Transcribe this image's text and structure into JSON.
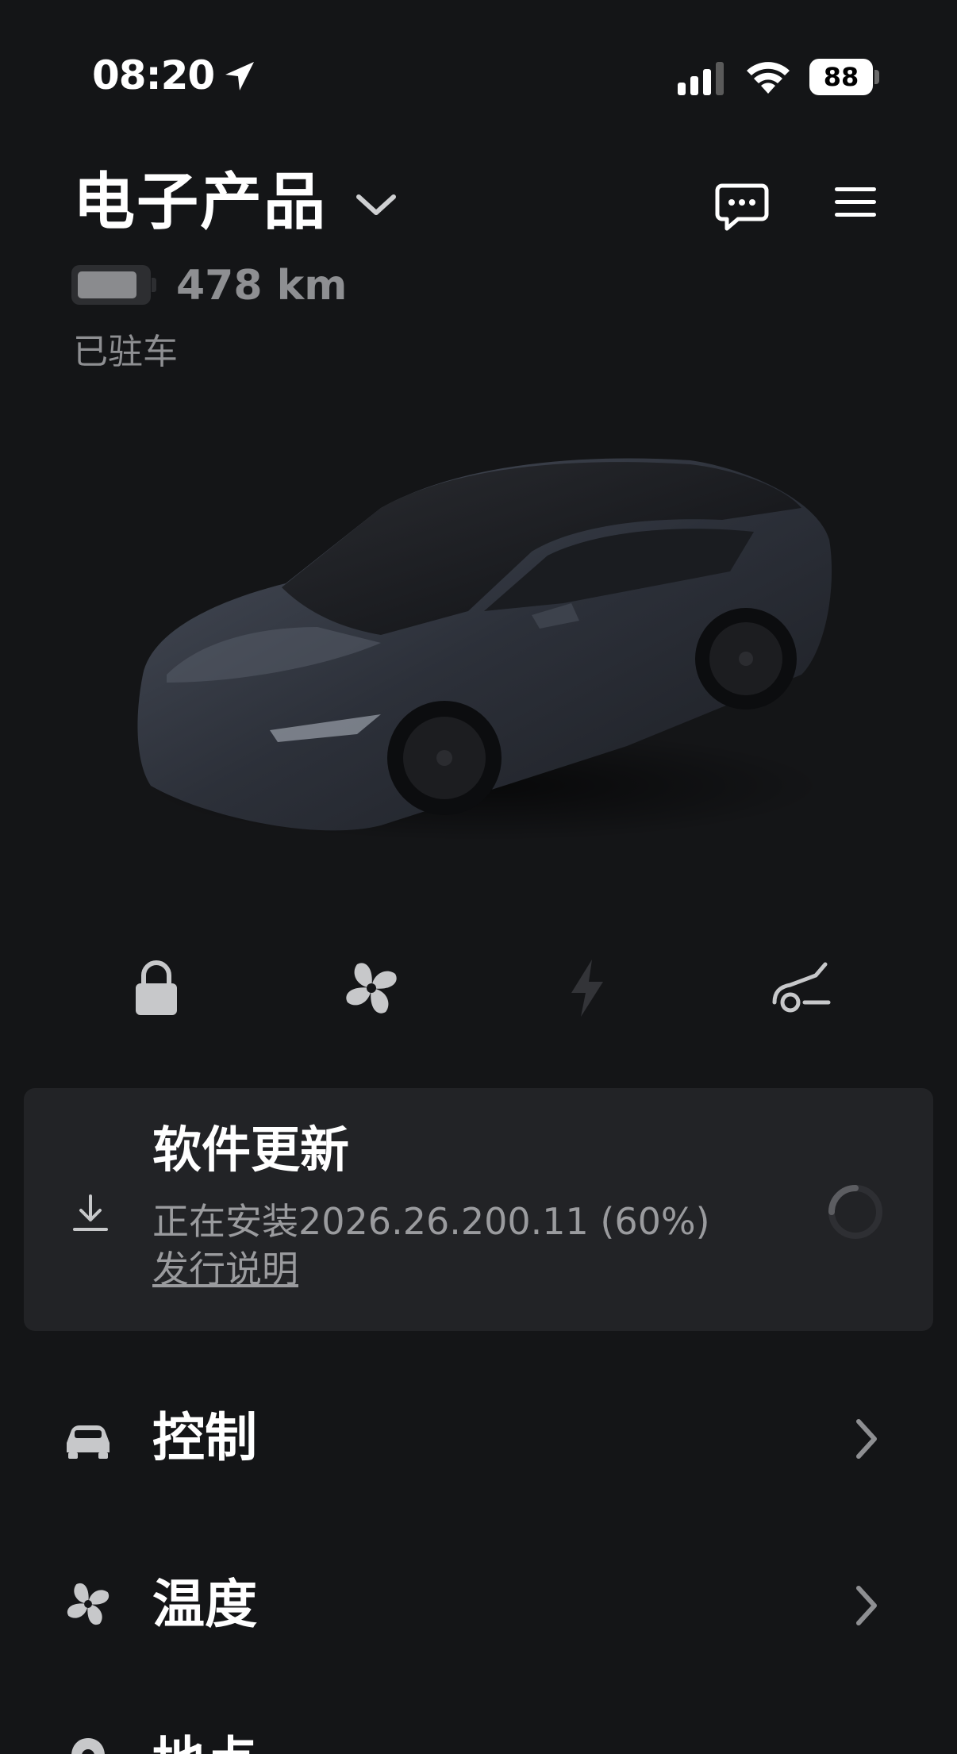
{
  "status_bar": {
    "time": "08:20",
    "battery_percent": "88",
    "icons": [
      "location-arrow-icon",
      "cellular-signal-icon",
      "wifi-icon",
      "battery-icon"
    ]
  },
  "header": {
    "vehicle_name": "电子产品",
    "range": "478 km",
    "battery_level": 0.88,
    "status": "已驻车",
    "icons": [
      "chevron-down-icon",
      "message-icon",
      "menu-icon"
    ]
  },
  "vehicle": {
    "image_icon": "car-image",
    "paint_color": "#3a3f4a"
  },
  "quick_actions": [
    {
      "name": "lock",
      "icon": "lock-icon",
      "color": "#c7c8ca"
    },
    {
      "name": "climate",
      "icon": "fan-icon",
      "color": "#c7c8ca"
    },
    {
      "name": "charge",
      "icon": "lightning-icon",
      "color": "#3a3b3e"
    },
    {
      "name": "trunk",
      "icon": "trunk-icon",
      "color": "#c7c8ca"
    }
  ],
  "software_update": {
    "title": "软件更新",
    "status": "正在安装2026.26.200.11 (60%)",
    "progress": 0.6,
    "link": "发行说明",
    "icon": "download-icon"
  },
  "menu": [
    {
      "label": "控制",
      "icon": "car-icon"
    },
    {
      "label": "温度",
      "icon": "fan-icon"
    },
    {
      "label": "地点",
      "icon": "location-icon"
    }
  ],
  "colors": {
    "background": "#141517",
    "card": "#222326",
    "secondary_text": "#8e8f92"
  }
}
